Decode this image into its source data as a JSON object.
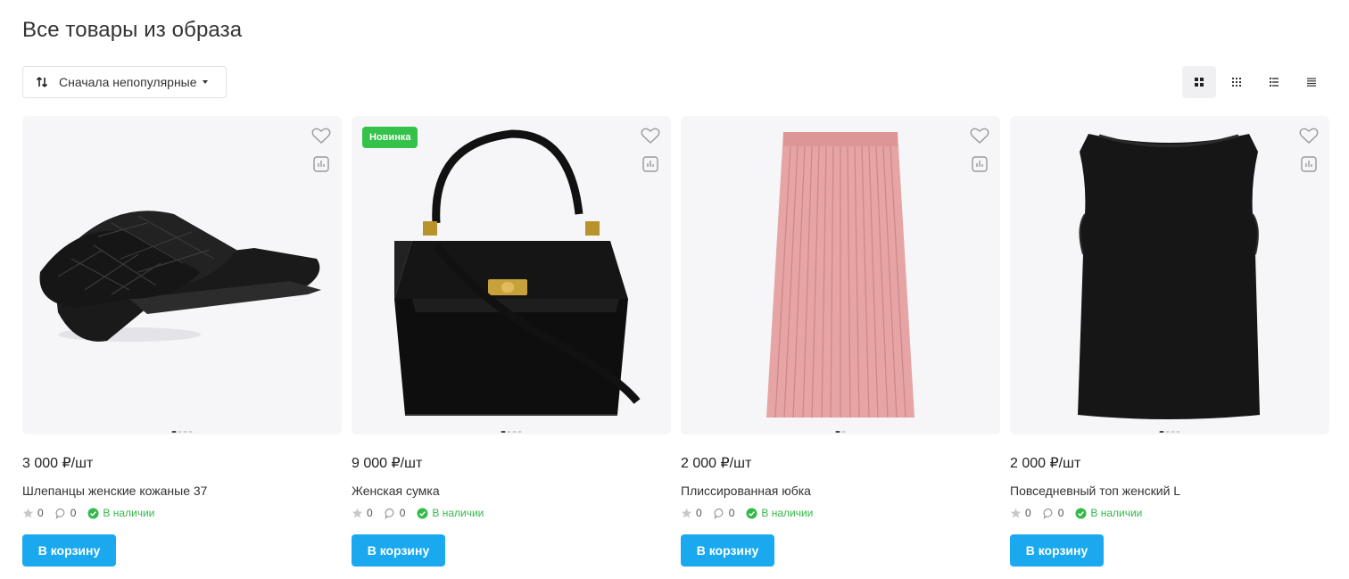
{
  "page": {
    "title": "Все товары из образа"
  },
  "sort": {
    "label": "Сначала непопулярные",
    "icon": "sort-arrows-icon"
  },
  "view_switch": {
    "options": [
      {
        "icon": "grid-large-icon",
        "active": true
      },
      {
        "icon": "grid-small-icon",
        "active": false
      },
      {
        "icon": "list-icon",
        "active": false
      },
      {
        "icon": "table-list-icon",
        "active": false
      }
    ]
  },
  "products": [
    {
      "name": "Шлепанцы женские кожаные 37",
      "price": "3 000",
      "unit": "₽/шт",
      "rating": "0",
      "comments": "0",
      "stock": "В наличии",
      "badge": "",
      "cart_label": "В корзину"
    },
    {
      "name": "Женская сумка",
      "price": "9 000",
      "unit": "₽/шт",
      "rating": "0",
      "comments": "0",
      "stock": "В наличии",
      "badge": "Новинка",
      "cart_label": "В корзину"
    },
    {
      "name": "Плиссированная юбка",
      "price": "2 000",
      "unit": "₽/шт",
      "rating": "0",
      "comments": "0",
      "stock": "В наличии",
      "badge": "",
      "cart_label": "В корзину"
    },
    {
      "name": "Повседневный топ женский L",
      "price": "2 000",
      "unit": "₽/шт",
      "rating": "0",
      "comments": "0",
      "stock": "В наличии",
      "badge": "",
      "cart_label": "В корзину"
    }
  ],
  "colors": {
    "accent": "#1aa9ef",
    "stock_green": "#33b84a",
    "badge_green": "#34c24a",
    "card_bg": "#f6f6f9"
  }
}
